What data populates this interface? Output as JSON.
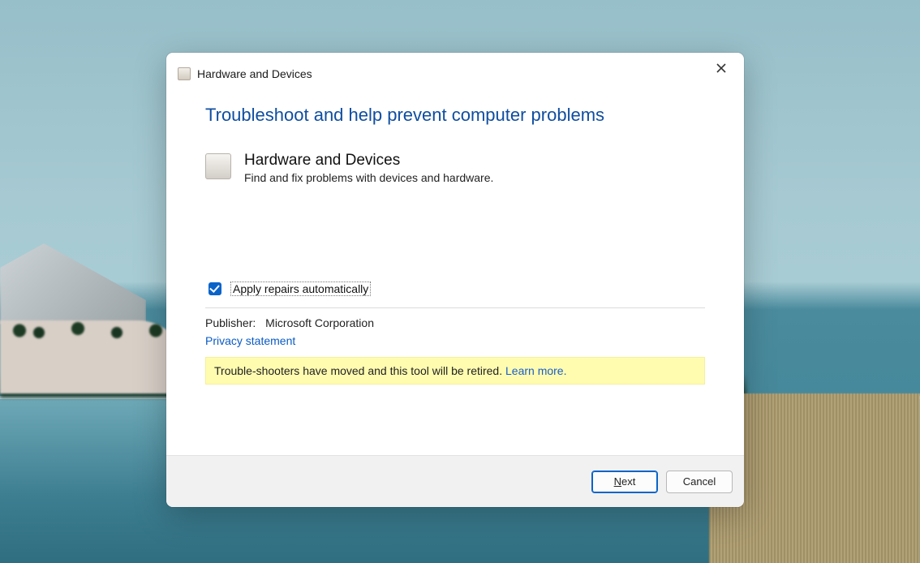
{
  "window": {
    "title": "Hardware and Devices"
  },
  "page": {
    "heading": "Troubleshoot and help prevent computer problems",
    "item": {
      "title": "Hardware and Devices",
      "description": "Find and fix problems with devices and hardware."
    }
  },
  "options": {
    "apply_repairs_label": "Apply repairs automatically",
    "apply_repairs_checked": true
  },
  "publisher": {
    "label": "Publisher:",
    "value": "Microsoft Corporation"
  },
  "links": {
    "privacy": "Privacy statement"
  },
  "notice": {
    "text": "Trouble-shooters have moved and this tool will be retired. ",
    "learn_more": "Learn more."
  },
  "buttons": {
    "next_prefix": "N",
    "next_suffix": "ext",
    "cancel": "Cancel"
  }
}
